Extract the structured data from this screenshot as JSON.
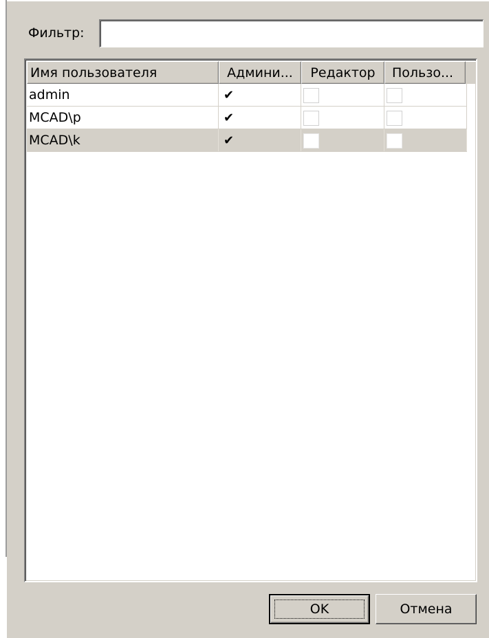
{
  "filter": {
    "label": "Фильтр:",
    "value": "",
    "placeholder": ""
  },
  "table": {
    "columns": [
      "Имя пользователя",
      "Админи...",
      "Редактор",
      "Пользо..."
    ],
    "rows": [
      {
        "user": "admin",
        "admin": true,
        "editor": false,
        "user_role": false,
        "selected": false
      },
      {
        "user": "MCAD\\p",
        "admin": true,
        "editor": false,
        "user_role": false,
        "selected": false
      },
      {
        "user": "MCAD\\k",
        "admin": true,
        "editor": false,
        "user_role": false,
        "selected": true
      }
    ]
  },
  "check_glyph": "✔",
  "buttons": {
    "ok": "OK",
    "cancel": "Отмена"
  },
  "colors": {
    "dialog_bg": "#d4d0c8",
    "list_bg": "#ffffff",
    "selected_row_bg": "#d4d0c8"
  }
}
